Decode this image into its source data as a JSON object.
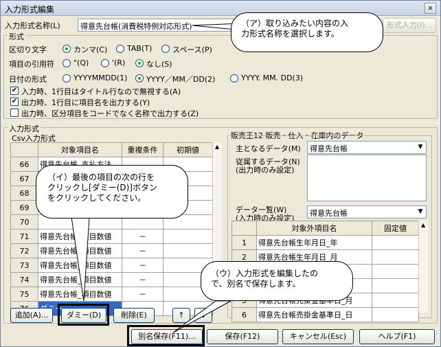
{
  "window": {
    "title": "入力形式編集",
    "close": "×"
  },
  "top": {
    "name_label": "入力形式名称(L)",
    "name_value": "得意先台帳(消費税特例対応形式)",
    "import_button": "形式入力(I)..."
  },
  "format": {
    "group_label": "形式",
    "delimiter_label": "区切り文字",
    "delimiter_options": [
      "カンマ(C)",
      "TAB(T)",
      "スペース(P)"
    ],
    "quote_label": "項目の引用符",
    "quote_options": [
      "\"(Q)",
      "'(R)",
      "なし(S)"
    ],
    "date_label": "日付の形式",
    "date_options": [
      "YYYYMMDD(1)",
      "YYYY／MM／DD(2)",
      "YYYY. MM. DD(3)"
    ],
    "checks": [
      {
        "label": "入力時、1行目はタイトル行なので無視する(A)",
        "checked": true
      },
      {
        "label": "出力時、1行目に項目名を出力する(Y)",
        "checked": true
      },
      {
        "label": "出力時、区分項目をコードでなく名称で出力する(Z)",
        "checked": false
      }
    ]
  },
  "input_format": {
    "group_label": "入力形式",
    "csv_label": "Csv入力形式",
    "headers": [
      "",
      "対象項目名",
      "重複条件",
      "初期値"
    ],
    "rows": [
      {
        "num": "66",
        "name": "得意先台帳_支払方法",
        "dup": "",
        "init": ""
      },
      {
        "num": "67",
        "name": "",
        "dup": "",
        "init": ""
      },
      {
        "num": "68",
        "name": "",
        "dup": "",
        "init": ""
      },
      {
        "num": "69",
        "name": "",
        "dup": "",
        "init": ""
      },
      {
        "num": "70",
        "name": "",
        "dup": "",
        "init": ""
      },
      {
        "num": "71",
        "name": "得意先台帳_項目数値",
        "dup": "－",
        "init": ""
      },
      {
        "num": "72",
        "name": "得意先台帳_項目数値",
        "dup": "－",
        "init": ""
      },
      {
        "num": "73",
        "name": "得意先台帳_項目数値",
        "dup": "－",
        "init": ""
      },
      {
        "num": "74",
        "name": "得意先台帳_項目数値",
        "dup": "－",
        "init": ""
      },
      {
        "num": "75",
        "name": "得意先台帳_項目数値",
        "dup": "－",
        "init": ""
      },
      {
        "num": "76",
        "name": "ダミー",
        "dup": "",
        "init": ""
      }
    ],
    "add_button": "追加(A)...",
    "dummy_button": "ダミー(D)",
    "delete_button": "削除(E)",
    "up_button": "↑",
    "down_button": "↓"
  },
  "right_panel": {
    "title": "販売王12 販売・仕入・在庫内のデータ",
    "main_data_label": "主となるデータ(M)",
    "main_data_value": "得意先台帳",
    "sub_data_label1": "従属するデータ(N)",
    "sub_data_label2": "(出力時のみ設定)",
    "data_list_label1": "データ一覧(W)",
    "data_list_label2": "(入力時のみ設定)",
    "data_list_value": "得意先台帳",
    "headers": [
      "",
      "対象外項目名",
      "固定値"
    ],
    "rows": [
      {
        "num": "1",
        "name": "得意先台帳生年月日_年",
        "fixed": ""
      },
      {
        "num": "2",
        "name": "得意先台帳生年月日_月",
        "fixed": ""
      },
      {
        "num": "3",
        "name": "得意先台帳生年月日_日",
        "fixed": ""
      },
      {
        "num": "4",
        "name": "得意先台帳売掛金基準日_年",
        "fixed": ""
      },
      {
        "num": "5",
        "name": "得意先台帳売掛金基準日_月",
        "fixed": ""
      },
      {
        "num": "6",
        "name": "得意先台帳売掛金基準日_日",
        "fixed": ""
      }
    ]
  },
  "bottom": {
    "save_as": "別名保存(F11)...",
    "save": "保存(F12)",
    "cancel": "キャンセル(Esc)",
    "help": "ヘルプ(F1)"
  },
  "callouts": {
    "a": [
      "（ア）取り込みたい内容の入",
      "力形式名称を選択します。"
    ],
    "i": [
      "（イ）最後の項目の次の行を",
      "クリックし[ダミー(D)]ボタン",
      "をクリックしてください。"
    ],
    "u": [
      "（ウ）入力形式を編集したの",
      "で、別名で保存します。"
    ]
  }
}
